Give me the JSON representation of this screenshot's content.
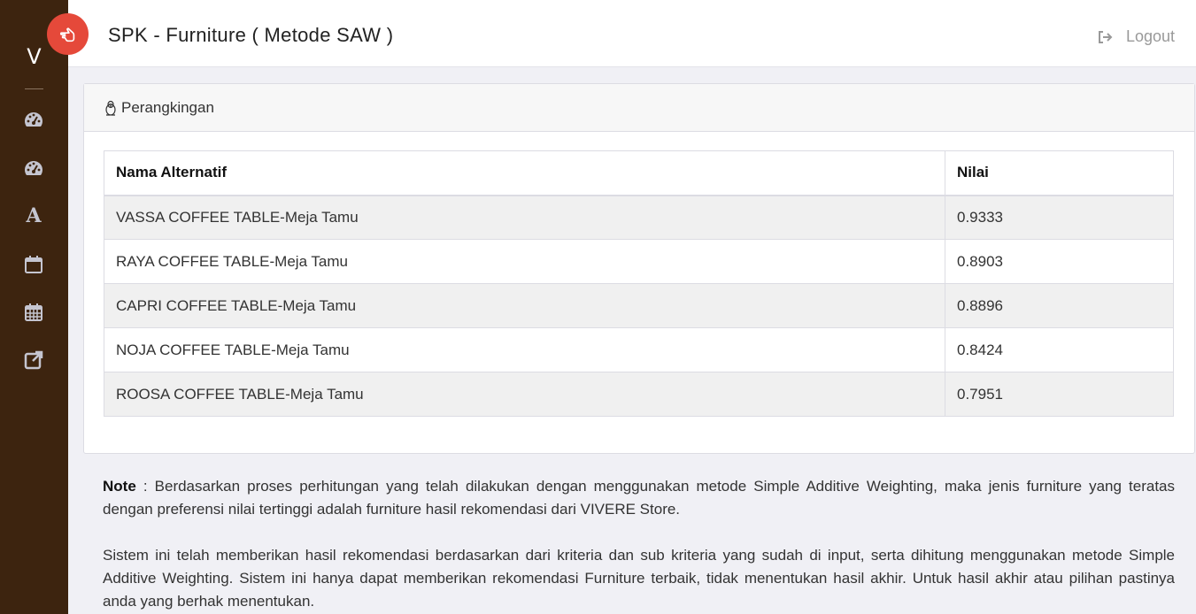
{
  "sidebar": {
    "brand": "V",
    "items": [
      {
        "icon": "dashboard-icon"
      },
      {
        "icon": "dashboard-icon"
      },
      {
        "icon": "font-icon",
        "glyph": "A"
      },
      {
        "icon": "calendar-icon"
      },
      {
        "icon": "calendar-grid-icon"
      },
      {
        "icon": "external-link-icon"
      }
    ]
  },
  "header": {
    "title": "SPK - Furniture ( Metode SAW )",
    "logout_label": "Logout",
    "toggle_icon": "hand-pointer-icon"
  },
  "card": {
    "heading": "Perangkingan",
    "heading_icon": "penguin-icon"
  },
  "table": {
    "headers": [
      "Nama Alternatif",
      "Nilai"
    ],
    "rows": [
      {
        "name": "VASSA COFFEE TABLE-Meja Tamu",
        "value": "0.9333"
      },
      {
        "name": "RAYA COFFEE TABLE-Meja Tamu",
        "value": "0.8903"
      },
      {
        "name": "CAPRI COFFEE TABLE-Meja Tamu",
        "value": "0.8896"
      },
      {
        "name": "NOJA COFFEE TABLE-Meja Tamu",
        "value": "0.8424"
      },
      {
        "name": "ROOSA COFFEE TABLE-Meja Tamu",
        "value": "0.7951"
      }
    ]
  },
  "note": {
    "label": "Note",
    "text1": " : Berdasarkan proses perhitungan yang telah dilakukan dengan menggunakan metode Simple Additive Weighting, maka jenis furniture yang teratas dengan preferensi nilai tertinggi adalah furniture hasil rekomendasi dari VIVERE Store.",
    "text2": "Sistem ini telah memberikan hasil rekomendasi berdasarkan dari kriteria dan sub kriteria yang sudah di input, serta dihitung menggunakan metode Simple Additive Weighting. Sistem ini hanya dapat memberikan rekomendasi Furniture terbaik, tidak menentukan hasil akhir. Untuk hasil akhir atau pilihan pastinya anda yang berhak menentukan."
  },
  "colors": {
    "sidebar_bg": "#3d240f",
    "toggle_bg": "#e5493a",
    "icon_muted": "#c5c5d0"
  }
}
